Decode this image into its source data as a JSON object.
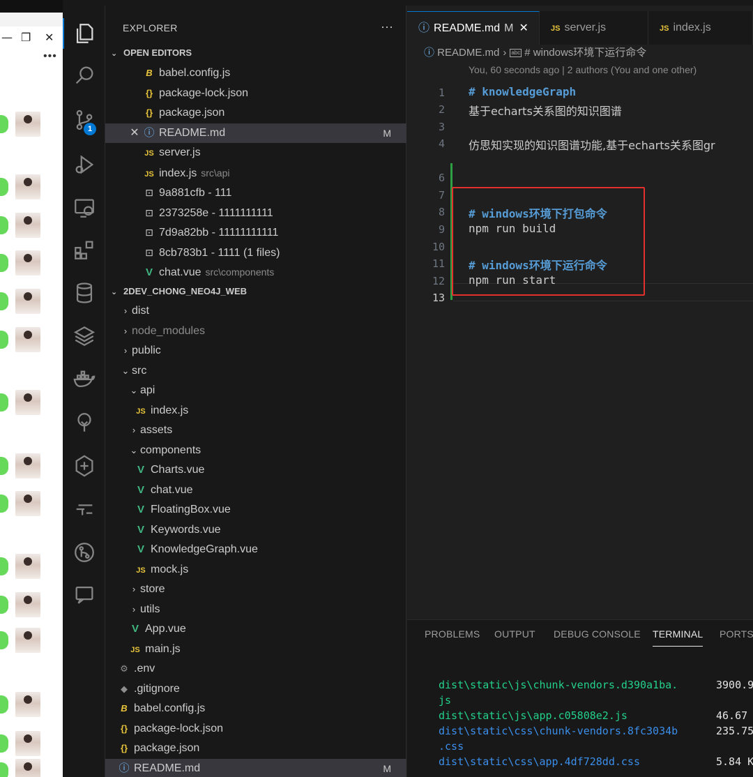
{
  "background_app": {
    "controls": [
      "—",
      "❐",
      "✕"
    ],
    "more": "•••"
  },
  "activity_bar": {
    "items": [
      {
        "name": "explorer",
        "icon": "files-icon"
      },
      {
        "name": "search",
        "icon": "search-icon"
      },
      {
        "name": "source-control",
        "icon": "source-control-icon",
        "badge": "1"
      },
      {
        "name": "run-debug",
        "icon": "run-debug-icon"
      },
      {
        "name": "remote-explorer",
        "icon": "remote-explorer-icon"
      },
      {
        "name": "extensions",
        "icon": "extensions-icon"
      },
      {
        "name": "database",
        "icon": "database-icon"
      },
      {
        "name": "layers",
        "icon": "layers-icon"
      },
      {
        "name": "docker",
        "icon": "docker-icon"
      },
      {
        "name": "tree",
        "icon": "tree-icon"
      },
      {
        "name": "gitkraken",
        "icon": "gitkraken-icon"
      },
      {
        "name": "deploy",
        "icon": "deploy-icon"
      },
      {
        "name": "git-graph",
        "icon": "git-graph-icon"
      },
      {
        "name": "chat",
        "icon": "chat-icon"
      }
    ]
  },
  "sidebar": {
    "title": "EXPLORER",
    "more": "···",
    "open_editors": {
      "title": "OPEN EDITORS",
      "items": [
        {
          "icon": "babel",
          "name": "babel.config.js",
          "detail": "",
          "status": ""
        },
        {
          "icon": "brace",
          "name": "package-lock.json",
          "detail": "",
          "status": ""
        },
        {
          "icon": "brace",
          "name": "package.json",
          "detail": "",
          "status": ""
        },
        {
          "icon": "info",
          "name": "README.md",
          "detail": "",
          "status": "M"
        },
        {
          "icon": "js",
          "name": "server.js",
          "detail": "",
          "status": ""
        },
        {
          "icon": "js",
          "name": "index.js",
          "detail": "src\\api",
          "status": ""
        },
        {
          "icon": "commit",
          "name": "9a881cfb - 111",
          "detail": "",
          "status": ""
        },
        {
          "icon": "commit",
          "name": "2373258e - 1111111111",
          "detail": "",
          "status": ""
        },
        {
          "icon": "commit",
          "name": "7d9a82bb - 11111111111",
          "detail": "",
          "status": ""
        },
        {
          "icon": "commit",
          "name": "8cb783b1 - 1111 (1 files)",
          "detail": "",
          "status": ""
        },
        {
          "icon": "vue",
          "name": "chat.vue",
          "detail": "src\\components",
          "status": ""
        }
      ]
    },
    "project": {
      "title": "2DEV_CHONG_NEO4J_WEB",
      "items": [
        {
          "chev": "›",
          "icon": "",
          "name": "dist"
        },
        {
          "chev": "›",
          "icon": "",
          "name": "node_modules",
          "gray": true
        },
        {
          "chev": "›",
          "icon": "",
          "name": "public"
        },
        {
          "chev": "⌄",
          "icon": "",
          "name": "src"
        },
        {
          "chev": "⌄",
          "icon": "",
          "name": "api"
        },
        {
          "chev": "",
          "icon": "js",
          "name": "index.js"
        },
        {
          "chev": "›",
          "icon": "",
          "name": "assets"
        },
        {
          "chev": "⌄",
          "icon": "",
          "name": "components"
        },
        {
          "chev": "",
          "icon": "vue",
          "name": "Charts.vue"
        },
        {
          "chev": "",
          "icon": "vue",
          "name": "chat.vue"
        },
        {
          "chev": "",
          "icon": "vue",
          "name": "FloatingBox.vue"
        },
        {
          "chev": "",
          "icon": "vue",
          "name": "Keywords.vue"
        },
        {
          "chev": "",
          "icon": "vue",
          "name": "KnowledgeGraph.vue"
        },
        {
          "chev": "",
          "icon": "js",
          "name": "mock.js"
        },
        {
          "chev": "›",
          "icon": "",
          "name": "store"
        },
        {
          "chev": "›",
          "icon": "",
          "name": "utils"
        },
        {
          "chev": "",
          "icon": "vue",
          "name": "App.vue"
        },
        {
          "chev": "",
          "icon": "js",
          "name": "main.js"
        },
        {
          "chev": "",
          "icon": "gear",
          "name": ".env"
        },
        {
          "chev": "",
          "icon": "git",
          "name": ".gitignore"
        },
        {
          "chev": "",
          "icon": "babel",
          "name": "babel.config.js"
        },
        {
          "chev": "",
          "icon": "brace",
          "name": "package-lock.json"
        },
        {
          "chev": "",
          "icon": "brace",
          "name": "package.json"
        },
        {
          "chev": "",
          "icon": "info",
          "name": "README.md",
          "status": "M"
        }
      ]
    }
  },
  "editor": {
    "tabs": [
      {
        "label": "README.md",
        "icon": "info",
        "status": "M",
        "close": "✕",
        "active": true
      },
      {
        "label": "server.js",
        "icon": "js"
      },
      {
        "label": "index.js",
        "icon": "js"
      }
    ],
    "breadcrumb": {
      "file": "README.md",
      "sep": "›",
      "symbol_icon": "abc",
      "symbol": "# windows环境下运行命令"
    },
    "blame": "You, 60 seconds ago | 2 authors (You and one other)",
    "lines": [
      {
        "n": "1",
        "text": "# knowledgeGraph",
        "kind": "head"
      },
      {
        "n": "2",
        "text": "基于echarts关系图的知识图谱",
        "kind": "cjk"
      },
      {
        "n": "3",
        "text": "",
        "kind": ""
      },
      {
        "n": "4",
        "text": "仿思知实现的知识图谱功能,基于echarts关系图gr",
        "kind": "cjk"
      },
      {
        "n": "6",
        "text": "",
        "kind": ""
      },
      {
        "n": "7",
        "text": "",
        "kind": ""
      },
      {
        "n": "8",
        "text": "# windows环境下打包命令",
        "kind": "head"
      },
      {
        "n": "9",
        "text": "npm run build",
        "kind": ""
      },
      {
        "n": "10",
        "text": "",
        "kind": ""
      },
      {
        "n": "11",
        "text": "# windows环境下运行命令",
        "kind": "head"
      },
      {
        "n": "12",
        "text": "npm run start",
        "kind": ""
      },
      {
        "n": "13",
        "text": "",
        "kind": "",
        "current": true
      }
    ]
  },
  "panel": {
    "tabs": [
      "PROBLEMS",
      "OUTPUT",
      "DEBUG CONSOLE",
      "TERMINAL",
      "PORTS"
    ],
    "active_tab": "TERMINAL",
    "terminal": [
      {
        "file": "dist\\static\\js\\chunk-vendors.d390a1ba.",
        "cont": "js",
        "size": "3900.9",
        "color": "green"
      },
      {
        "file": "dist\\static\\js\\app.c05808e2.js",
        "cont": "",
        "size": "46.67",
        "color": "green"
      },
      {
        "file": "dist\\static\\css\\chunk-vendors.8fc3034b",
        "cont": ".css",
        "size": "235.75",
        "color": "blue"
      },
      {
        "file": "dist\\static\\css\\app.4df728dd.css",
        "cont": "",
        "size": "5.84 K",
        "color": "blue"
      }
    ]
  }
}
